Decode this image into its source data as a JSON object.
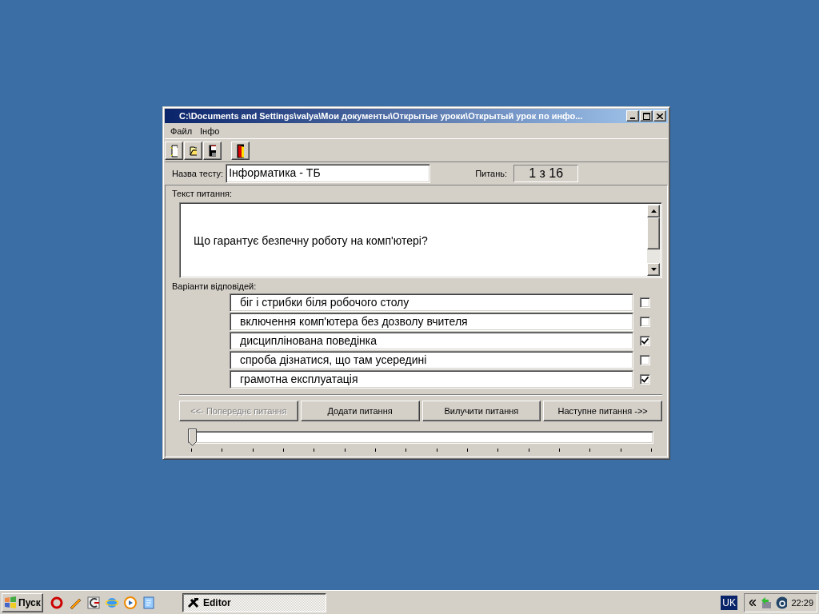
{
  "window": {
    "title": "C:\\Documents and Settings\\valya\\Мои документы\\Открытые уроки\\Открытый урок по инфо..."
  },
  "menu": [
    "Файл",
    "Інфо"
  ],
  "test_name": {
    "label": "Назва тесту:",
    "value": "Інформатика - ТБ"
  },
  "question_count": {
    "label": "Питань:",
    "value": "1 з 16"
  },
  "question": {
    "label": "Текст питання:",
    "text": "Що гарантує безпечну роботу на комп'ютері?"
  },
  "answers": {
    "label": "Варіанти відповідей:",
    "items": [
      {
        "text": "біг і стрибки біля робочого столу",
        "checked": false
      },
      {
        "text": "включення комп'ютера без дозволу вчителя",
        "checked": false
      },
      {
        "text": "дисциплінована поведінка",
        "checked": true
      },
      {
        "text": "спроба дізнатися, що там усередині",
        "checked": false
      },
      {
        "text": "грамотна експлуатація",
        "checked": true
      }
    ]
  },
  "buttons": [
    {
      "label": "<<- Попереднє питання",
      "disabled": true
    },
    {
      "label": "Додати питання",
      "disabled": false
    },
    {
      "label": "Вилучити питання",
      "disabled": false
    },
    {
      "label": "Наступне питання ->>",
      "disabled": false
    }
  ],
  "slider": {
    "level": 0
  },
  "taskbar": {
    "start": "Пуск",
    "task": {
      "label": "Editor",
      "selected": true
    },
    "language": "UK",
    "clock": "22:29"
  }
}
